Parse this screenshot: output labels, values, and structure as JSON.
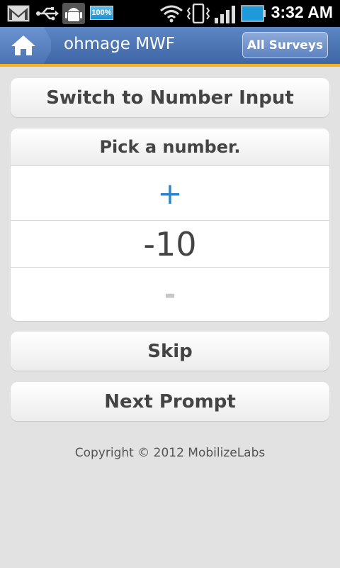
{
  "status_bar": {
    "time": "3:32 AM",
    "battery_left_label": "100%",
    "icons": [
      "gmail-icon",
      "usb-icon",
      "android-debug-icon",
      "battery-full-icon",
      "wifi-icon",
      "vibrate-icon",
      "signal-icon",
      "battery-icon"
    ]
  },
  "title_bar": {
    "home_icon": "home-icon",
    "title": "ohmage MWF",
    "all_surveys_label": "All Surveys",
    "accent_color": "#f5b21a",
    "bar_color": "#4a73b3"
  },
  "switch_button_label": "Switch to Number Input",
  "prompt": {
    "question": "Pick a number.",
    "increment_symbol": "+",
    "value": "-10",
    "decrement_symbol": "-",
    "increment_color": "#2d86c9"
  },
  "skip_label": "Skip",
  "next_label": "Next Prompt",
  "copyright": "Copyright © 2012 MobilizeLabs"
}
